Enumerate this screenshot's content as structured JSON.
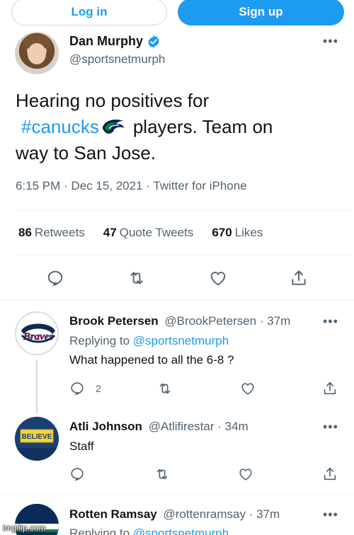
{
  "auth": {
    "login_label": "Log in",
    "signup_label": "Sign up"
  },
  "tweet": {
    "author_name": "Dan Murphy",
    "author_handle": "@sportsnetmurph",
    "text_part1": "Hearing no positives for",
    "hashtag": "#canucks",
    "text_part2": "players. Team on",
    "text_part3": "way to San Jose.",
    "time": "6:15 PM",
    "date": "Dec 15, 2021",
    "source": "Twitter for iPhone",
    "sep": " · ",
    "retweets_count": "86",
    "retweets_label": "Retweets",
    "quotes_count": "47",
    "quotes_label": "Quote Tweets",
    "likes_count": "670",
    "likes_label": "Likes"
  },
  "replies": [
    {
      "name": "Brook Petersen",
      "handle": "@BrookPetersen",
      "time": "· 37m",
      "replying_prefix": "Replying to",
      "replying_handle": "@sportsnetmurph",
      "text": "What happened to all the 6-8 ?",
      "reply_count": "2"
    },
    {
      "name": "Atli Johnson",
      "handle": "@Atlifirestar",
      "time": "· 34m",
      "text": "Staff"
    },
    {
      "name": "Rotten Ramsay",
      "handle": "@rottenramsay",
      "time": "· 37m",
      "replying_prefix": "Replying to",
      "replying_handle": "@sportsnetmurph"
    }
  ],
  "watermark": "imgflip.com",
  "colors": {
    "accent": "#1d9bf0",
    "muted": "#536471",
    "text": "#0f1419"
  }
}
